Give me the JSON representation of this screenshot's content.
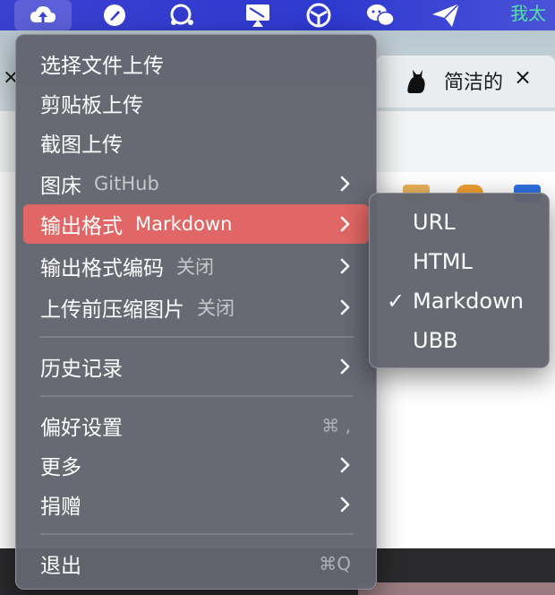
{
  "menubar": {
    "icons": [
      "cloud-upload-icon",
      "pen-nib-icon",
      "chat-bubble-icon",
      "airplay-icon",
      "steering-wheel-icon",
      "wechat-icon",
      "paper-plane-icon"
    ],
    "right_text": "我太"
  },
  "background": {
    "tab_title": "简洁的",
    "tab_close": "×",
    "left_close": "×"
  },
  "menu": {
    "items": [
      {
        "label": "选择文件上传"
      },
      {
        "label": "剪贴板上传"
      },
      {
        "label": "截图上传"
      },
      {
        "label": "图床",
        "sub": "GitHub",
        "has_submenu": true
      },
      {
        "label": "输出格式",
        "sub": "Markdown",
        "has_submenu": true,
        "selected": true
      },
      {
        "label": "输出格式编码",
        "sub": "关闭",
        "has_submenu": true
      },
      {
        "label": "上传前压缩图片",
        "sub": "关闭",
        "has_submenu": true
      },
      {
        "label": "历史记录",
        "has_submenu": true
      },
      {
        "label": "偏好设置",
        "shortcut": "⌘ ,"
      },
      {
        "label": "更多",
        "has_submenu": true
      },
      {
        "label": "捐赠",
        "has_submenu": true
      },
      {
        "label": "退出",
        "shortcut": "⌘Q"
      }
    ]
  },
  "submenu": {
    "items": [
      {
        "label": "URL",
        "checked": false
      },
      {
        "label": "HTML",
        "checked": false
      },
      {
        "label": "Markdown",
        "checked": true
      },
      {
        "label": "UBB",
        "checked": false
      }
    ],
    "check_glyph": "✓"
  },
  "colors": {
    "menu_bg": "#62646e",
    "selected": "#e06765",
    "menubar": "#2e39cf",
    "subtext": "#c7c8cc"
  }
}
